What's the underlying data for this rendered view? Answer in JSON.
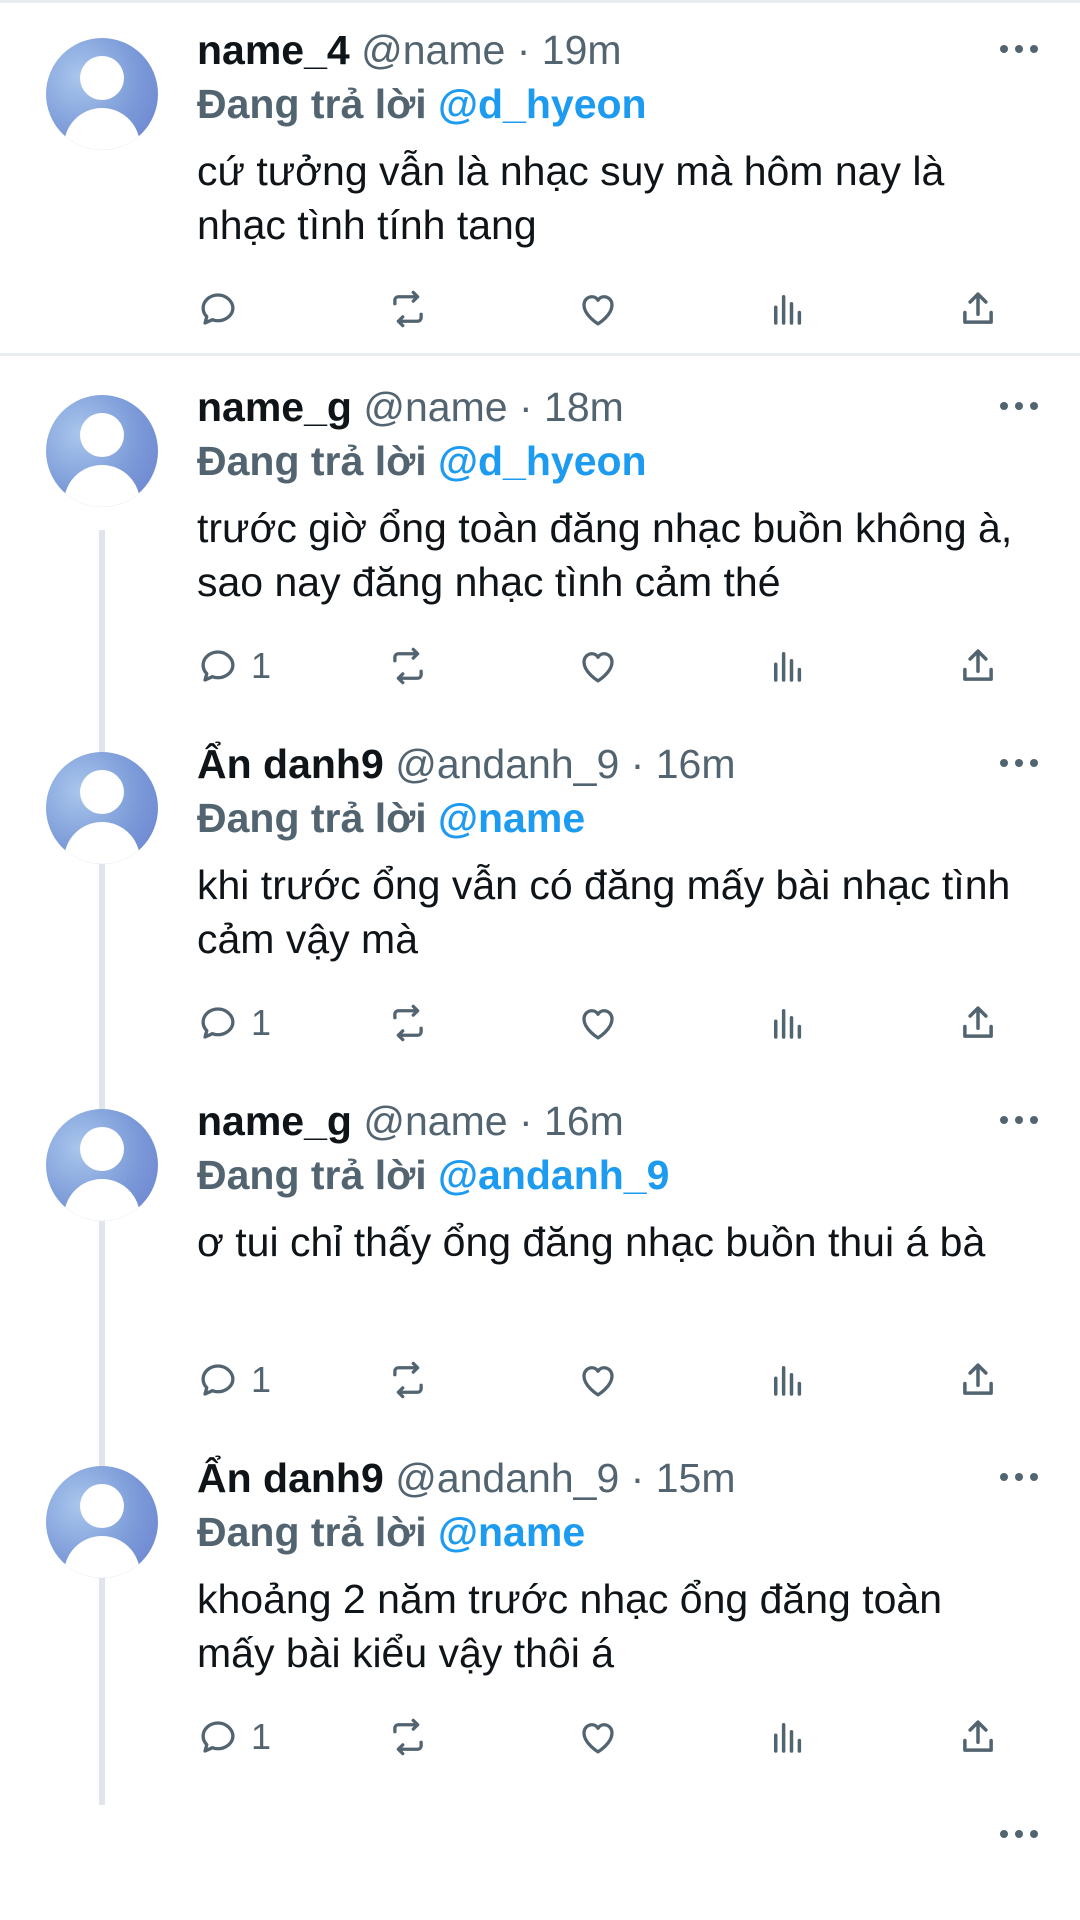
{
  "tweets": [
    {
      "name": "name_4",
      "handle": "@name",
      "dot": "·",
      "time": "19m",
      "reply_label": "Đang trả lời",
      "reply_to": "@d_hyeon",
      "text": "cứ tưởng vẫn là nhạc suy mà hôm nay là nhạc tình tính tang",
      "reply_count": ""
    },
    {
      "name": "name_g",
      "handle": "@name",
      "dot": "·",
      "time": "18m",
      "reply_label": "Đang trả lời",
      "reply_to": "@d_hyeon",
      "text": "trước giờ ổng toàn đăng nhạc buồn không à, sao nay đăng nhạc tình cảm thé",
      "reply_count": "1"
    },
    {
      "name": "Ẩn danh9",
      "handle": "@andanh_9",
      "dot": "·",
      "time": "16m",
      "reply_label": "Đang trả lời",
      "reply_to": "@name",
      "text": "khi trước ổng vẫn có đăng mấy bài nhạc tình cảm vậy mà",
      "reply_count": "1"
    },
    {
      "name": "name_g",
      "handle": "@name",
      "dot": "·",
      "time": "16m",
      "reply_label": "Đang trả lời",
      "reply_to": "@andanh_9",
      "text": "ơ tui chỉ thấy ổng đăng nhạc buồn thui á bà",
      "reply_count": "1"
    },
    {
      "name": "Ẩn danh9",
      "handle": "@andanh_9",
      "dot": "·",
      "time": "15m",
      "reply_label": "Đang trả lời",
      "reply_to": "@name",
      "text": "khoảng 2 năm trước nhạc ổng đăng toàn mấy bài kiểu vậy thôi á",
      "reply_count": "1"
    }
  ],
  "icons": {
    "reply": "reply-icon",
    "retweet": "retweet-icon",
    "like": "heart-icon",
    "views": "views-icon",
    "share": "share-icon",
    "more": "more-icon"
  },
  "colors": {
    "mention": "#1d9bf0",
    "secondary_text": "#536471",
    "thread_line": "#dfe5ea"
  }
}
